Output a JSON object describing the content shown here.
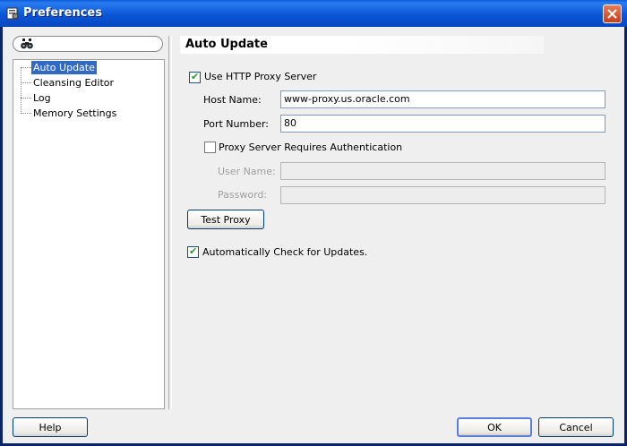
{
  "window": {
    "title": "Preferences"
  },
  "search": {
    "placeholder": ""
  },
  "tree": {
    "items": [
      {
        "label": "Auto Update",
        "selected": true
      },
      {
        "label": "Cleansing Editor"
      },
      {
        "label": "Log"
      },
      {
        "label": "Memory Settings"
      }
    ]
  },
  "panel": {
    "title": "Auto Update",
    "use_proxy": {
      "label": "Use HTTP Proxy Server",
      "checked": true
    },
    "host": {
      "label": "Host Name:",
      "value": "www-proxy.us.oracle.com"
    },
    "port": {
      "label": "Port Number:",
      "value": "80"
    },
    "auth": {
      "label": "Proxy Server Requires Authentication",
      "checked": false
    },
    "user": {
      "label": "User Name:",
      "value": ""
    },
    "password": {
      "label": "Password:",
      "value": ""
    },
    "test_button": "Test Proxy",
    "auto_check": {
      "label": "Automatically Check for Updates.",
      "checked": true
    }
  },
  "footer": {
    "help": "Help",
    "ok": "OK",
    "cancel": "Cancel"
  },
  "colors": {
    "titlebar": "#0b56d6",
    "selection": "#316ac5",
    "client": "#efefef"
  }
}
